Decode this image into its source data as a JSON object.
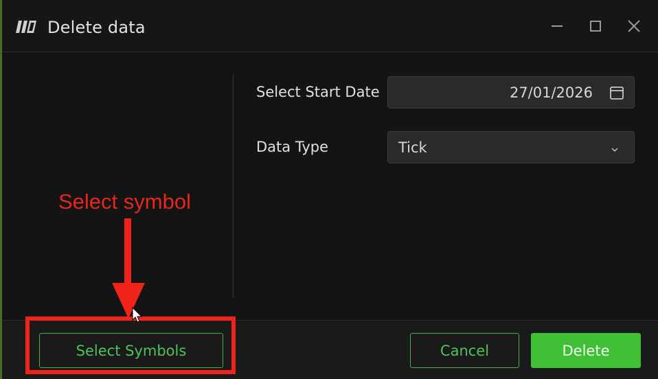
{
  "window": {
    "title": "Delete data",
    "icons": {
      "app": "app-logo-icon",
      "minimize": "minimize-icon",
      "maximize": "maximize-icon",
      "close": "close-icon"
    }
  },
  "form": {
    "start_date": {
      "label": "Select Start Date",
      "value": "27/01/2026",
      "icon": "calendar-icon"
    },
    "data_type": {
      "label": "Data Type",
      "value": "Tick",
      "icon": "chevron-down-icon"
    }
  },
  "footer": {
    "select_symbols_label": "Select Symbols",
    "cancel_label": "Cancel",
    "delete_label": "Delete"
  },
  "annotation": {
    "text": "Select symbol"
  },
  "colors": {
    "accent_green": "#3fbf34",
    "annotation_red": "#e8261c",
    "background": "#141414"
  }
}
